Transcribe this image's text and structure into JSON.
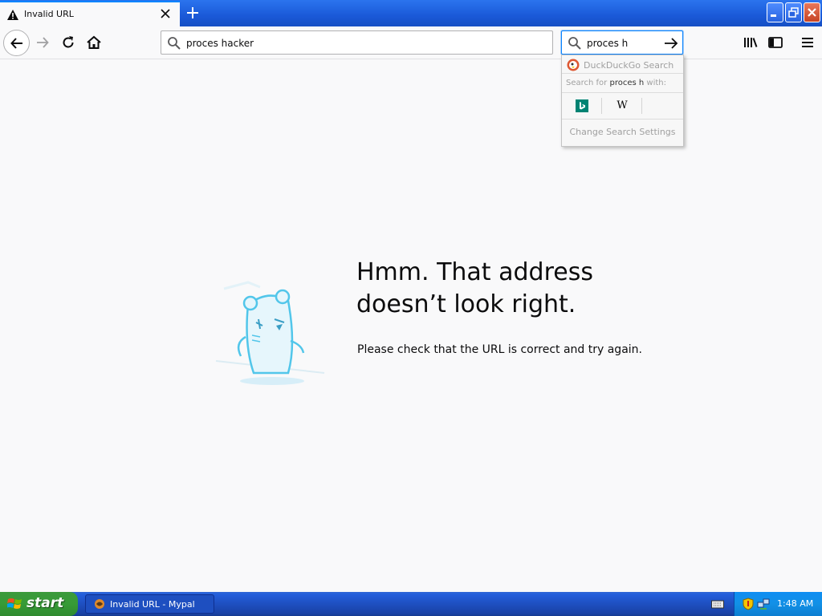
{
  "tab": {
    "title": "Invalid URL"
  },
  "urlbar": {
    "value": "proces hacker"
  },
  "searchbar": {
    "value": "proces h"
  },
  "search_popup": {
    "engine_label": "DuckDuckGo Search",
    "search_for_prefix": "Search for",
    "search_for_query": "proces h",
    "search_for_suffix": "with:",
    "wiki_glyph": "W",
    "settings_label": "Change Search Settings"
  },
  "error": {
    "title_line1": "Hmm. That address",
    "title_line2": "doesn’t look right.",
    "description": "Please check that the URL is correct and try again."
  },
  "taskbar": {
    "start_label": "start",
    "task_label": "Invalid URL - Mypal",
    "clock": "1:48 AM"
  },
  "colors": {
    "accent": "#0a84ff",
    "xp_blue": "#245edb",
    "xp_green": "#379b37",
    "page_bg": "#f9f9fa"
  },
  "icons": [
    "warning-icon",
    "close-icon",
    "plus-icon",
    "back-arrow-icon",
    "forward-arrow-icon",
    "reload-icon",
    "home-icon",
    "search-icon",
    "go-arrow-icon",
    "library-icon",
    "sidebar-icon",
    "hamburger-menu-icon",
    "duckduckgo-icon",
    "bing-icon",
    "wikipedia-icon",
    "windows-logo-icon",
    "keyboard-icon",
    "security-shield-icon",
    "network-icon"
  ]
}
